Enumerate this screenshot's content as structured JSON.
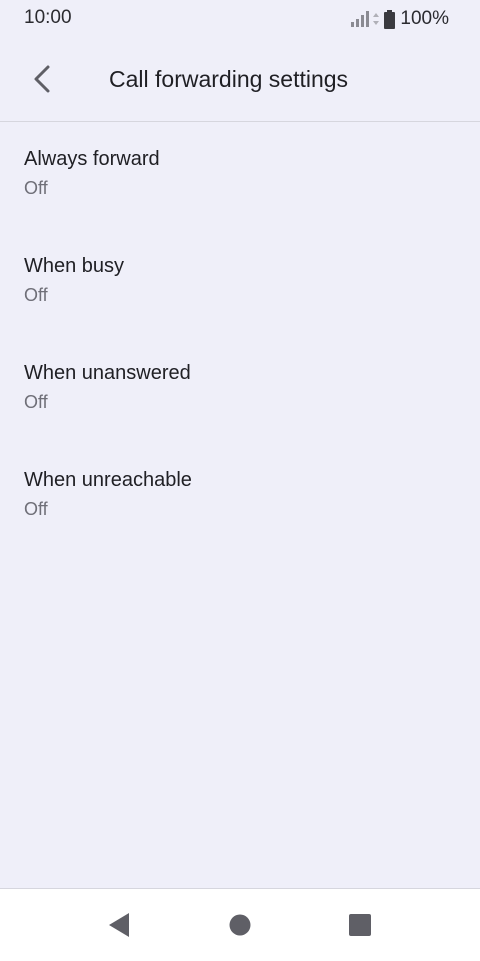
{
  "status_bar": {
    "time": "10:00",
    "battery": "100%",
    "icons": [
      "signal-icon",
      "data-icon",
      "battery-icon"
    ]
  },
  "app_bar": {
    "title": "Call forwarding settings",
    "back_icon": "chevron-left-icon"
  },
  "settings": [
    {
      "title": "Always forward",
      "summary": "Off"
    },
    {
      "title": "When busy",
      "summary": "Off"
    },
    {
      "title": "When unanswered",
      "summary": "Off"
    },
    {
      "title": "When unreachable",
      "summary": "Off"
    }
  ],
  "nav_bar": {
    "icons": [
      "back-triangle-icon",
      "home-circle-icon",
      "recents-square-icon"
    ]
  },
  "colors": {
    "background": "#efeff9",
    "divider": "#d6d6de",
    "title_text": "#1f1f24",
    "summary_text": "#6f6f78",
    "nav_icon": "#5f5f66"
  }
}
